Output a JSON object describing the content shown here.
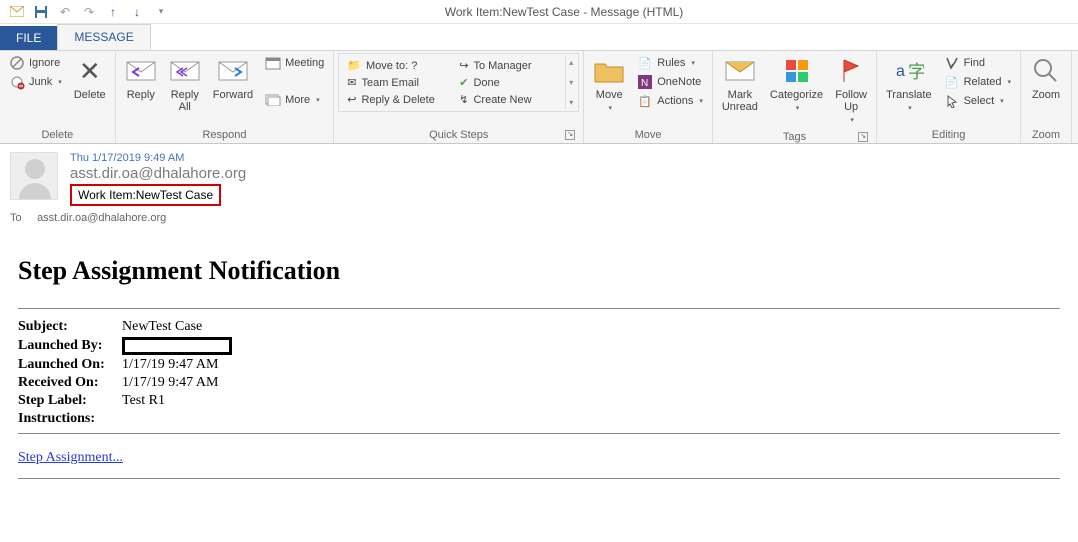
{
  "window": {
    "title": "Work Item:NewTest Case - Message (HTML)"
  },
  "tabs": {
    "file": "FILE",
    "message": "MESSAGE"
  },
  "ribbon": {
    "delete": {
      "ignore": "Ignore",
      "junk": "Junk",
      "delete": "Delete",
      "group": "Delete"
    },
    "respond": {
      "reply": "Reply",
      "replyAll": "Reply\nAll",
      "forward": "Forward",
      "meeting": "Meeting",
      "more": "More",
      "group": "Respond"
    },
    "quicksteps": {
      "moveTo": "Move to: ?",
      "teamEmail": "Team Email",
      "replyDelete": "Reply & Delete",
      "toManager": "To Manager",
      "done": "Done",
      "createNew": "Create New",
      "group": "Quick Steps"
    },
    "move": {
      "move": "Move",
      "rules": "Rules",
      "onenote": "OneNote",
      "actions": "Actions",
      "group": "Move"
    },
    "tags": {
      "markUnread": "Mark\nUnread",
      "categorize": "Categorize",
      "followUp": "Follow\nUp",
      "group": "Tags"
    },
    "editing": {
      "translate": "Translate",
      "find": "Find",
      "related": "Related",
      "select": "Select",
      "group": "Editing"
    },
    "zoom": {
      "zoom": "Zoom",
      "group": "Zoom"
    }
  },
  "message": {
    "date": "Thu 1/17/2019 9:49 AM",
    "from": "asst.dir.oa@dhalahore.org",
    "subject": "Work Item:NewTest Case",
    "toLabel": "To",
    "to": "asst.dir.oa@dhalahore.org"
  },
  "body": {
    "title": "Step Assignment Notification",
    "fields": {
      "subject": {
        "label": "Subject:",
        "value": "NewTest Case"
      },
      "launchedBy": {
        "label": "Launched By:"
      },
      "launchedOn": {
        "label": "Launched On:",
        "value": "1/17/19 9:47 AM"
      },
      "receivedOn": {
        "label": "Received On:",
        "value": "1/17/19 9:47 AM"
      },
      "stepLabel": {
        "label": "Step Label:",
        "value": "Test R1"
      },
      "instructions": {
        "label": "Instructions:"
      }
    },
    "link": "Step Assignment..."
  }
}
